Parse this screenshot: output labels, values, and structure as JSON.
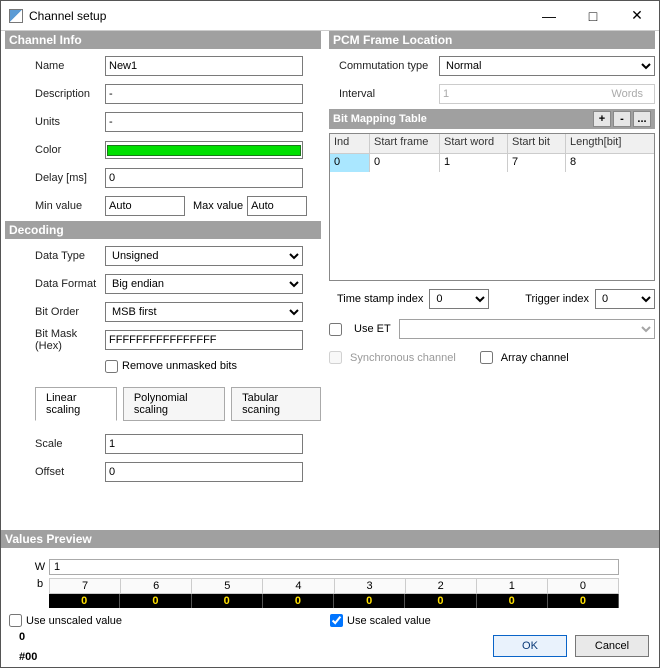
{
  "window": {
    "title": "Channel setup",
    "min": "—",
    "max": "□",
    "close": "✕"
  },
  "channel_info": {
    "header": "Channel Info",
    "name_label": "Name",
    "name": "New1",
    "desc_label": "Description",
    "desc": "-",
    "units_label": "Units",
    "units": "-",
    "color_label": "Color",
    "color": "#00e000",
    "delay_label": "Delay [ms]",
    "delay": "0",
    "min_label": "Min value",
    "min": "Auto",
    "max_label": "Max value",
    "max": "Auto"
  },
  "decoding": {
    "header": "Decoding",
    "datatype_label": "Data Type",
    "datatype": "Unsigned",
    "dataformat_label": "Data Format",
    "dataformat": "Big endian",
    "bitorder_label": "Bit Order",
    "bitorder": "MSB first",
    "bitmask_label": "Bit Mask (Hex)",
    "bitmask": "FFFFFFFFFFFFFFFF",
    "remove_label": "Remove unmasked bits",
    "remove": false
  },
  "pcm": {
    "header": "PCM Frame Location",
    "commutation_label": "Commutation type",
    "commutation": "Normal",
    "interval_label": "Interval",
    "interval": "1",
    "interval_units": "Words"
  },
  "bitmap": {
    "header": "Bit Mapping Table",
    "btn_add": "+",
    "btn_del": "-",
    "btn_more": "...",
    "cols": [
      "Ind",
      "Start frame",
      "Start word",
      "Start bit",
      "Length[bit]"
    ],
    "rows": [
      {
        "ind": "0",
        "sf": "0",
        "sw": "1",
        "sb": "7",
        "len": "8"
      }
    ]
  },
  "timestamp": {
    "label": "Time stamp index",
    "value": "0",
    "trigger_label": "Trigger index",
    "trigger_value": "0"
  },
  "useet": {
    "label": "Use ET",
    "checked": false
  },
  "sync": {
    "label": "Synchronous channel",
    "checked": false,
    "array_label": "Array channel",
    "array_checked": false
  },
  "tabs": {
    "linear": "Linear scaling",
    "poly": "Polynomial scaling",
    "tab": "Tabular scaning",
    "active": "linear"
  },
  "scale": {
    "label": "Scale",
    "value": "1",
    "offset_label": "Offset",
    "offset_value": "0"
  },
  "values_preview": {
    "header": "Values Preview",
    "w_label": "W",
    "w_value": "1",
    "b_label": "b",
    "bit_headers": [
      "7",
      "6",
      "5",
      "4",
      "3",
      "2",
      "1",
      "0"
    ],
    "bit_values": [
      "0",
      "0",
      "0",
      "0",
      "0",
      "0",
      "0",
      "0"
    ]
  },
  "bottom": {
    "unscaled_label": "Use unscaled value",
    "unscaled_checked": false,
    "scaled_label": "Use scaled value",
    "scaled_checked": true,
    "val_dec": "0",
    "val_hex": "#00",
    "ok": "OK",
    "cancel": "Cancel"
  }
}
